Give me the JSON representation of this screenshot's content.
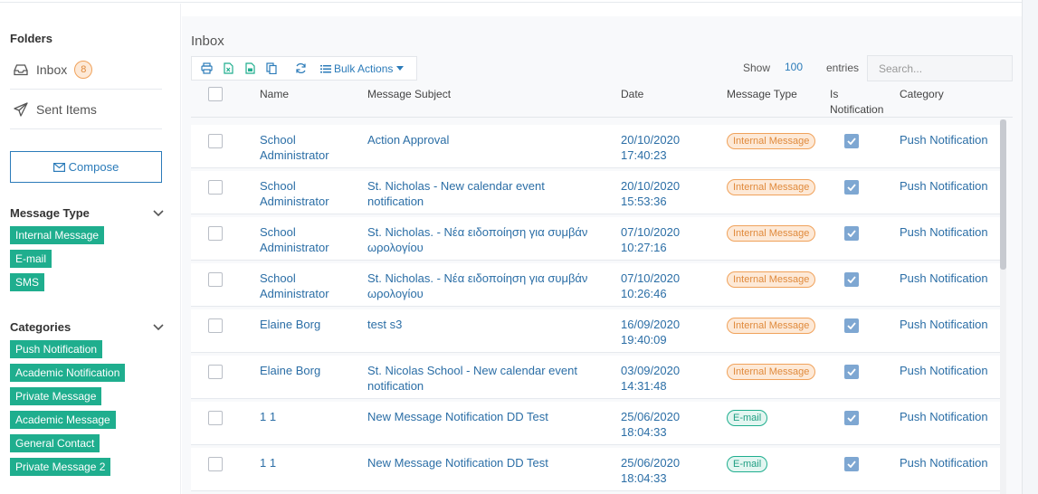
{
  "sidebar": {
    "folders_title": "Folders",
    "inbox_label": "Inbox",
    "inbox_count": "8",
    "sent_label": "Sent Items",
    "compose_label": "Compose",
    "message_type_title": "Message Type",
    "message_types": [
      "Internal Message",
      "E-mail",
      "SMS"
    ],
    "categories_title": "Categories",
    "categories": [
      "Push Notification",
      "Academic Notification",
      "Private Message",
      "Academic Message",
      "General Contact",
      "Private Message 2"
    ]
  },
  "main": {
    "title": "Inbox",
    "bulk_actions_label": "Bulk Actions",
    "show_label": "Show",
    "show_value": "100",
    "entries_label": "entries",
    "search_placeholder": "Search...",
    "columns": [
      "Name",
      "Message Subject",
      "Date",
      "Message Type",
      "Is\nNotification",
      "Category"
    ],
    "toolbar_icons": [
      "print-icon",
      "excel-icon",
      "csv-icon",
      "copy-icon",
      "refresh-icon",
      "list-icon"
    ]
  },
  "rows": [
    {
      "name": "School\nAdministrator",
      "subject": "Action Approval",
      "date": "20/10/2020\n17:40:23",
      "type": "Internal Message",
      "type_kind": "internal",
      "notification": true,
      "category": "Push Notification"
    },
    {
      "name": "School\nAdministrator",
      "subject": "St. Nicholas - New calendar event\nnotification",
      "date": "20/10/2020\n15:53:36",
      "type": "Internal Message",
      "type_kind": "internal",
      "notification": true,
      "category": "Push Notification"
    },
    {
      "name": "School\nAdministrator",
      "subject": "St. Nicholas. - Νέα ειδοποίηση για συμβάν\nωρολογίου",
      "date": "07/10/2020\n10:27:16",
      "type": "Internal Message",
      "type_kind": "internal",
      "notification": true,
      "category": "Push Notification"
    },
    {
      "name": "School\nAdministrator",
      "subject": "St. Nicholas. - Νέα ειδοποίηση για συμβάν\nωρολογίου",
      "date": "07/10/2020\n10:26:46",
      "type": "Internal Message",
      "type_kind": "internal",
      "notification": true,
      "category": "Push Notification"
    },
    {
      "name": "Elaine Borg",
      "subject": "test s3",
      "date": "16/09/2020\n19:40:09",
      "type": "Internal Message",
      "type_kind": "internal",
      "notification": true,
      "category": "Push Notification"
    },
    {
      "name": "Elaine Borg",
      "subject": "St. Nicolas School - New calendar event\nnotification",
      "date": "03/09/2020\n14:31:48",
      "type": "Internal Message",
      "type_kind": "internal",
      "notification": true,
      "category": "Push Notification"
    },
    {
      "name": "1 1",
      "subject": "New Message Notification DD Test",
      "date": "25/06/2020\n18:04:33",
      "type": "E-mail",
      "type_kind": "email",
      "notification": true,
      "category": "Push Notification"
    },
    {
      "name": "1 1",
      "subject": "New Message Notification DD Test",
      "date": "25/06/2020\n18:04:33",
      "type": "E-mail",
      "type_kind": "email",
      "notification": true,
      "category": "Push Notification"
    }
  ],
  "colors": {
    "accent": "#2b7bb9",
    "tag_green": "#1fae8e",
    "badge_orange": "#e08a3c"
  }
}
